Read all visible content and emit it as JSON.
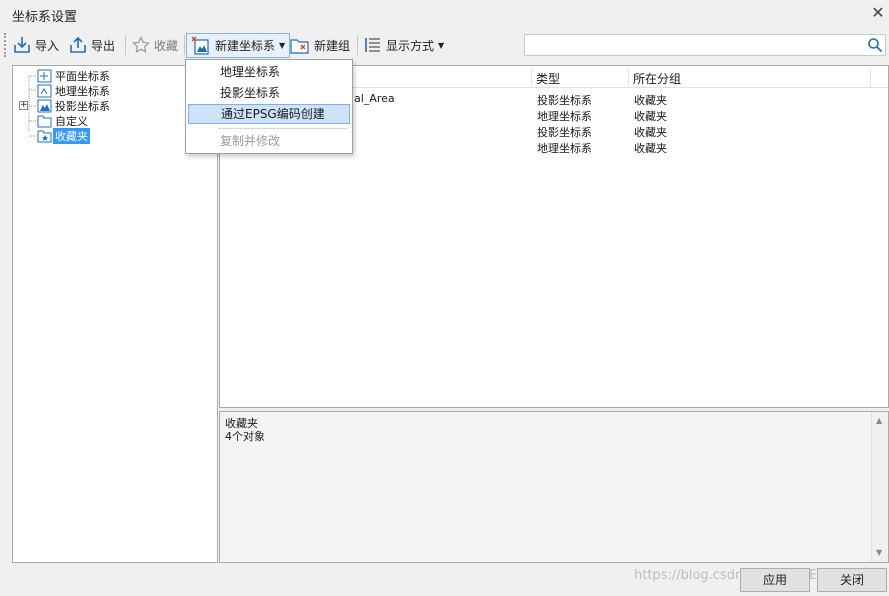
{
  "window": {
    "title": "坐标系设置"
  },
  "toolbar": {
    "import_label": "导入",
    "export_label": "导出",
    "favorite_label": "收藏",
    "new_crs_label": "新建坐标系",
    "new_group_label": "新建组",
    "display_mode_label": "显示方式",
    "search_placeholder": ""
  },
  "new_crs_menu": {
    "items": [
      {
        "label": "地理坐标系"
      },
      {
        "label": "投影坐标系"
      },
      {
        "label": "通过EPSG编码创建"
      },
      {
        "label": "复制并修改"
      }
    ]
  },
  "tree": {
    "items": [
      {
        "label": "平面坐标系"
      },
      {
        "label": "地理坐标系"
      },
      {
        "label": "投影坐标系"
      },
      {
        "label": "自定义"
      },
      {
        "label": "收藏夹"
      }
    ]
  },
  "list": {
    "headers": {
      "name": "",
      "type": "类型",
      "group": "所在分组"
    },
    "rows": [
      {
        "name": "al_Area",
        "type": "投影坐标系",
        "group": "收藏夹"
      },
      {
        "name": "",
        "type": "地理坐标系",
        "group": "收藏夹"
      },
      {
        "name": "",
        "type": "投影坐标系",
        "group": "收藏夹"
      },
      {
        "name": "",
        "type": "地理坐标系",
        "group": "收藏夹"
      }
    ]
  },
  "info": {
    "line1": "收藏夹",
    "line2": "4个对象"
  },
  "buttons": {
    "apply_label": "应用",
    "close_label": "关闭"
  },
  "watermark": "https://blog.csdn.net/THEDEAMON",
  "colors": {
    "selection": "#3399ff",
    "menu_highlight": "#cfe4fb",
    "accent_icon": "#1f6fbf",
    "warn_icon": "#e04020"
  }
}
